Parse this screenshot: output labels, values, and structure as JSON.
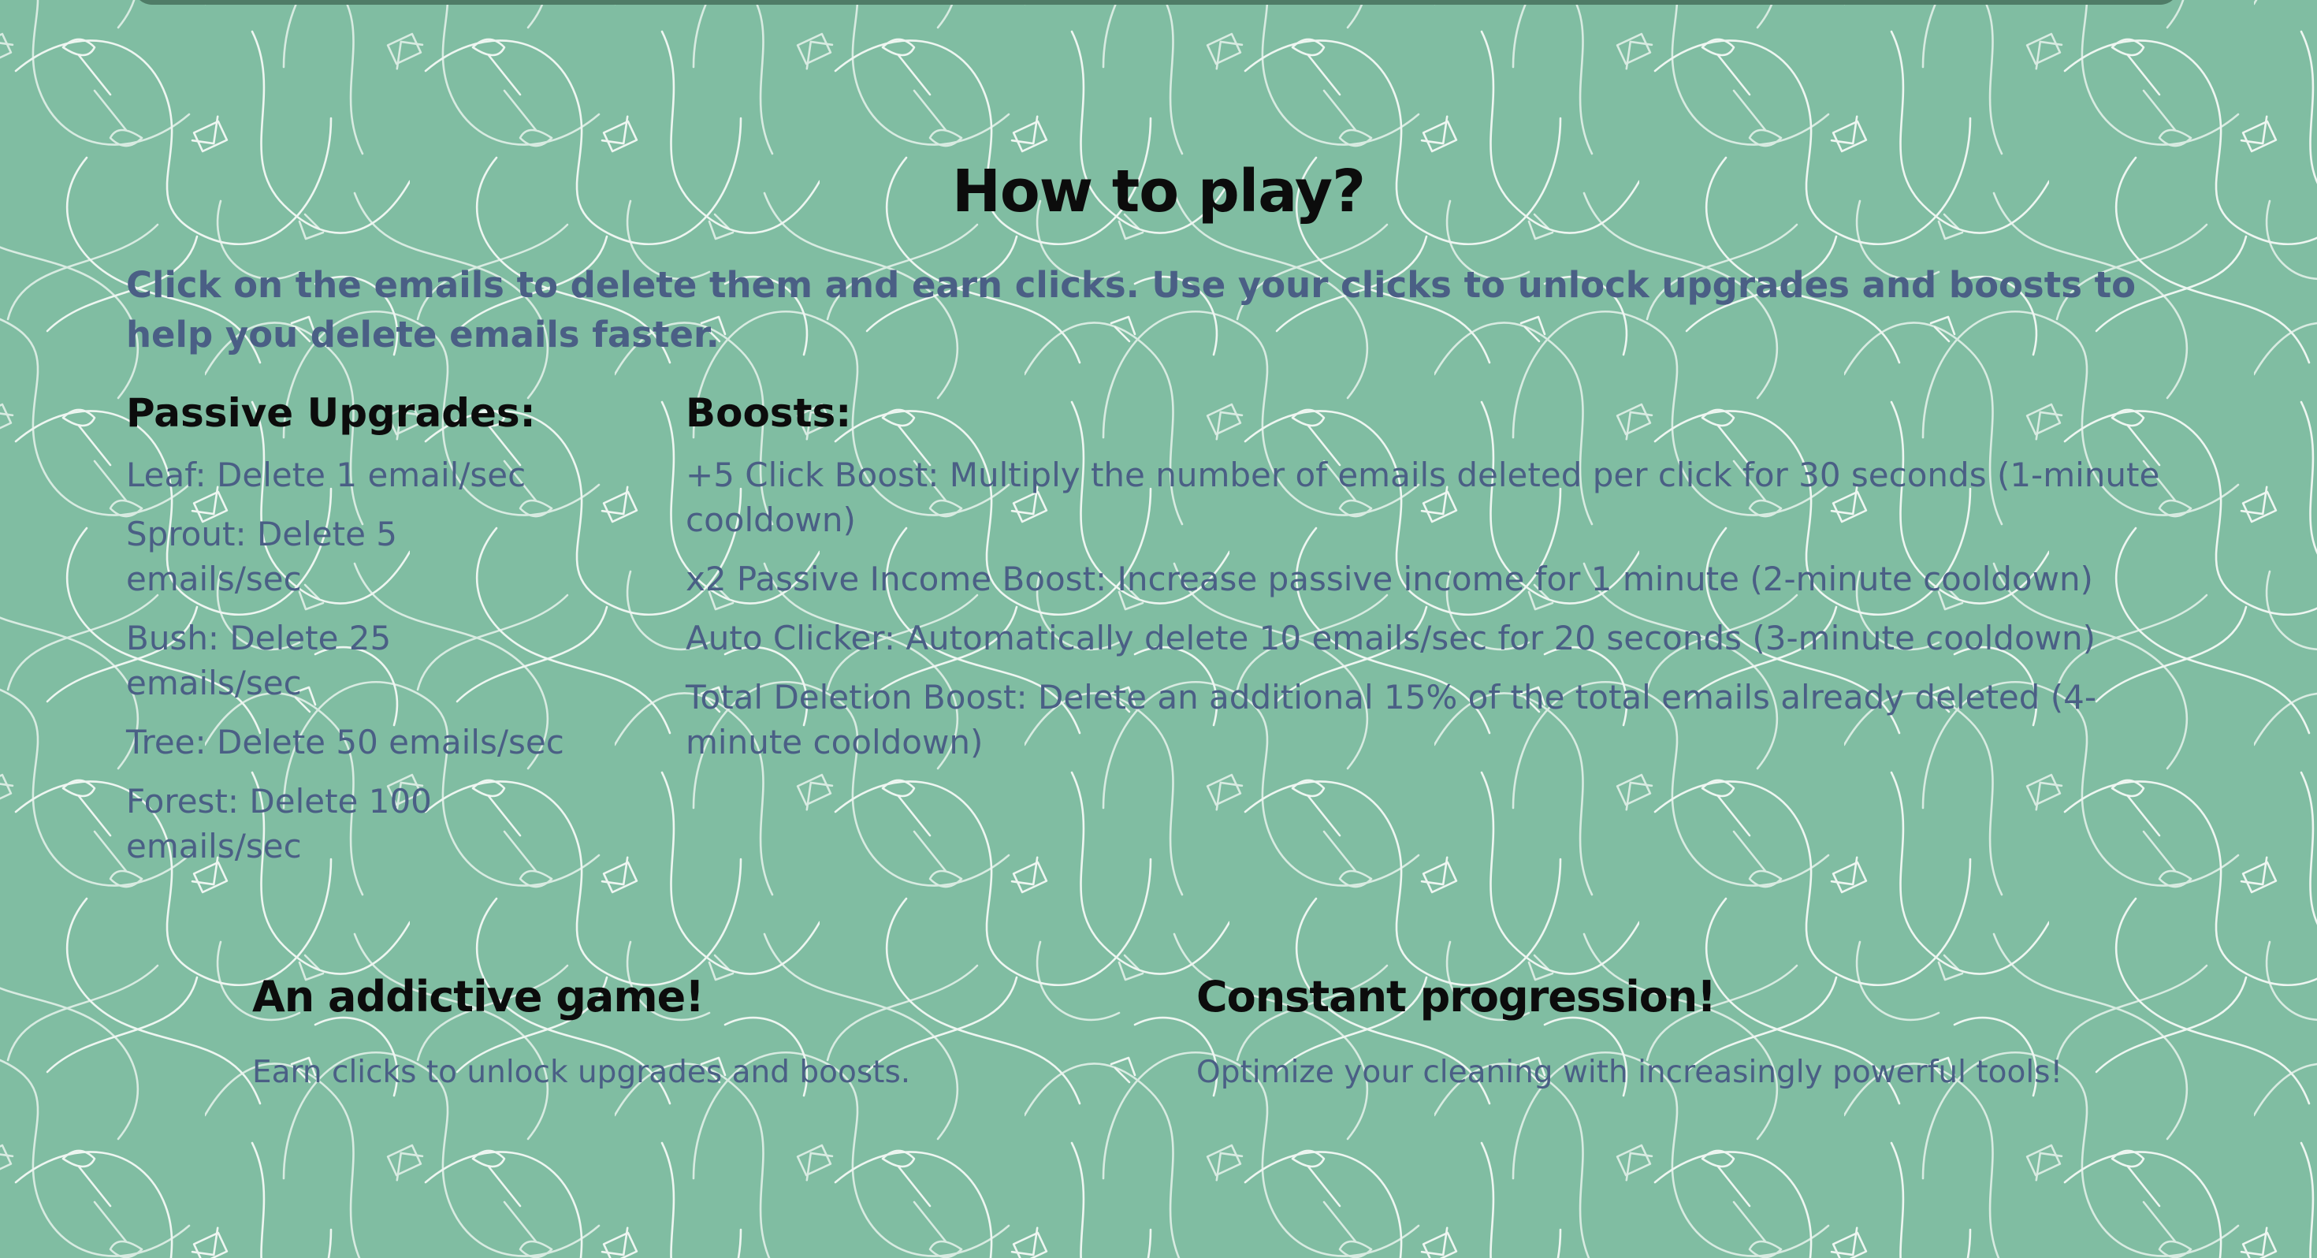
{
  "colors": {
    "background": "#80bda2",
    "pattern_stroke": "#eef6f1",
    "top_bar": "#4f7c67",
    "heading_text": "#0c0c0c",
    "body_text": "#4a5f85"
  },
  "background_pattern": {
    "icons": [
      "envelope-icon",
      "broom-icon",
      "squiggle-line"
    ]
  },
  "how_to_play": {
    "title": "How to play?",
    "intro": "Click on the emails to delete them and earn clicks. Use your clicks to unlock upgrades and boosts to help you delete emails faster."
  },
  "passive_upgrades": {
    "heading": "Passive Upgrades:",
    "items": [
      "Leaf: Delete 1 email/sec",
      "Sprout: Delete 5 emails/sec",
      "Bush: Delete 25 emails/sec",
      "Tree: Delete 50 emails/sec",
      "Forest: Delete 100 emails/sec"
    ]
  },
  "boosts": {
    "heading": "Boosts:",
    "items": [
      "+5 Click Boost: Multiply the number of emails deleted per click for 30 seconds (1-minute cooldown)",
      "x2 Passive Income Boost: Increase passive income for 1 minute (2-minute cooldown)",
      "Auto Clicker: Automatically delete 10 emails/sec for 20 seconds (3-minute cooldown)",
      "Total Deletion Boost: Delete an additional 15% of the total emails already deleted (4-minute cooldown)"
    ]
  },
  "features": [
    {
      "title": "An addictive game!",
      "description": "Earn clicks to unlock upgrades and boosts."
    },
    {
      "title": "Constant progression!",
      "description": "Optimize your cleaning with increasingly powerful tools!"
    }
  ]
}
